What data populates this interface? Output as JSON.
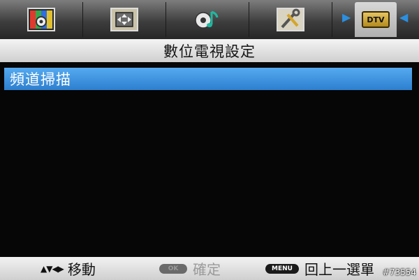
{
  "tabs": [
    {
      "icon": "picture-settings-icon"
    },
    {
      "icon": "screen-adjust-icon"
    },
    {
      "icon": "sound-settings-icon"
    },
    {
      "icon": "setup-tools-icon"
    },
    {
      "icon": "dtv-icon",
      "label": "DTV",
      "active": true
    }
  ],
  "title": "數位電視設定",
  "menu": {
    "items": [
      {
        "label": "頻道掃描",
        "selected": true
      }
    ]
  },
  "footer": {
    "navigate_label": "移動",
    "ok_key": "OK",
    "ok_label": "確定",
    "menu_key": "MENU",
    "menu_label": "回上一選單"
  },
  "watermark": "#73554",
  "colors": {
    "highlight": "#3d8fdc",
    "panel": "#060606",
    "arrow": "#2b8fe0"
  }
}
